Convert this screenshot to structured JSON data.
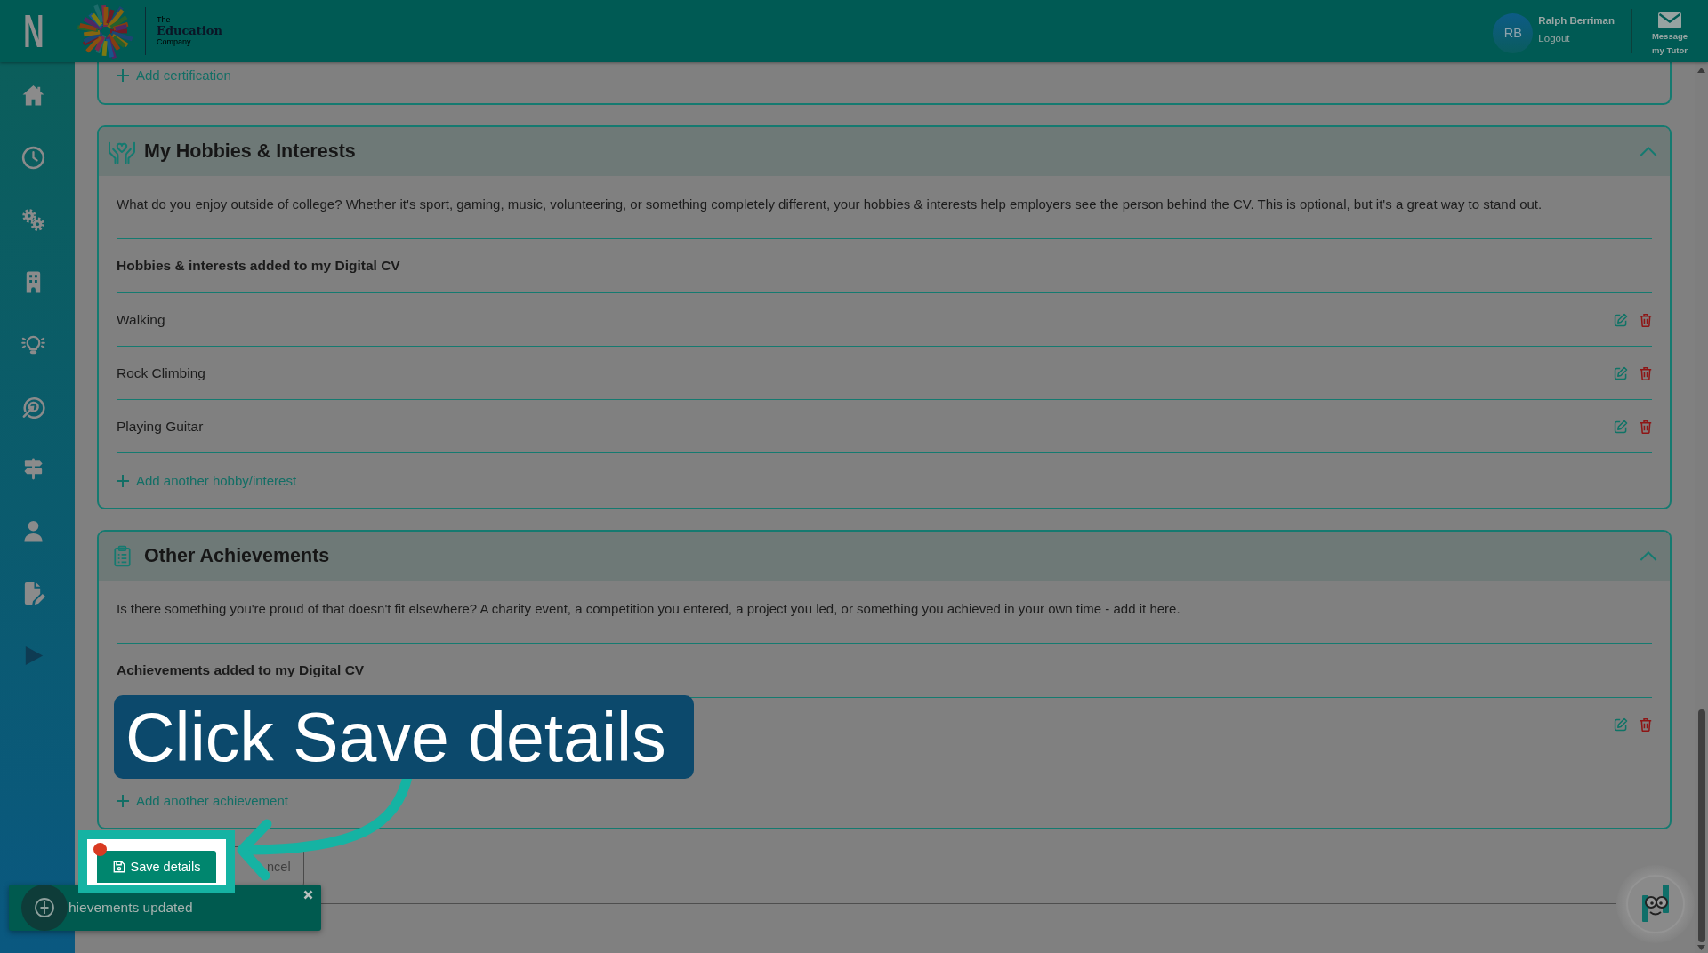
{
  "app_logo": "N",
  "brand": {
    "prefix": "The",
    "name": "Education",
    "suffix": "Company"
  },
  "user": {
    "initials": "RB",
    "name": "Ralph Berriman",
    "logout": "Logout"
  },
  "message_button": {
    "lines": [
      "Message",
      "my Tutor"
    ]
  },
  "certifications": {
    "add_link": "Add certification"
  },
  "sections": [
    {
      "kind": "hobbies",
      "title": "My Hobbies & Interests",
      "expanded": true,
      "description": "What do you enjoy outside of college? Whether it's sport, gaming, music, volunteering, or something completely different, your hobbies & interests help employers see the person behind the CV. This is optional, but it's a great way to stand out.",
      "list_heading": "Hobbies & interests added to my Digital CV",
      "items": [
        {
          "label": "Walking",
          "editable": true
        },
        {
          "label": "Rock Climbing",
          "editable": true
        },
        {
          "label": "Playing Guitar",
          "editable": true
        }
      ],
      "add_link": "Add another hobby/interest"
    },
    {
      "kind": "achievements",
      "title": "Other Achievements",
      "expanded": true,
      "description": "Is there something you're proud of that doesn't fit elsewhere? A charity event, a competition you entered, a project you led, or something you achieved in your own time - add it here.",
      "list_heading": "Achievements added to my Digital CV",
      "items": [
        {
          "editable": true
        }
      ],
      "add_link": "Add another achievement"
    }
  ],
  "actions": {
    "save_button": "Save details",
    "cancel_button": "ncel"
  },
  "toast": {
    "message": "hievements updated"
  },
  "tutorial": {
    "callout": "Click Save details"
  }
}
